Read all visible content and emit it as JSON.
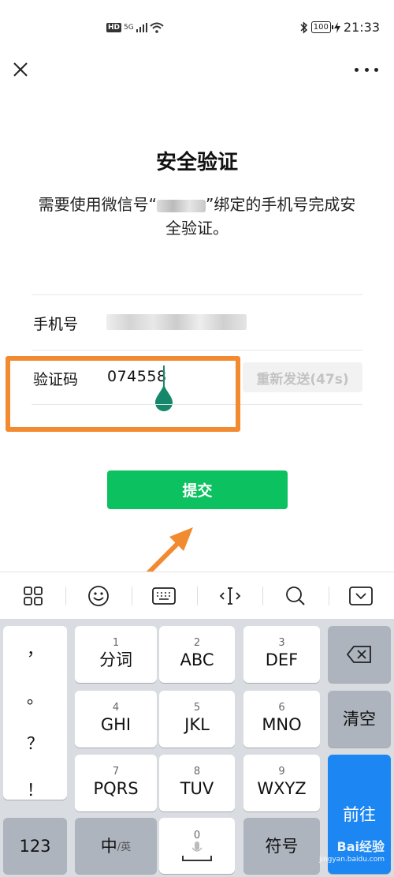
{
  "status_bar": {
    "network": "HD",
    "signal": "5G",
    "battery": "100",
    "time": "21:33"
  },
  "page": {
    "title": "安全验证",
    "desc_prefix": "需要使用微信号“",
    "desc_suffix": "”绑定的手机号完成安全验证。"
  },
  "form": {
    "phone_label": "手机号",
    "code_label": "验证码",
    "code_value": "074558",
    "resend_label": "重新发送(47s)"
  },
  "submit_label": "提交",
  "keyboard": {
    "punctuation": [
      "，",
      "。",
      "？",
      "！"
    ],
    "row1": [
      {
        "num": "1",
        "label": "分词"
      },
      {
        "num": "2",
        "label": "ABC"
      },
      {
        "num": "3",
        "label": "DEF"
      }
    ],
    "row2": [
      {
        "num": "4",
        "label": "GHI"
      },
      {
        "num": "5",
        "label": "JKL"
      },
      {
        "num": "6",
        "label": "MNO"
      }
    ],
    "row3": [
      {
        "num": "7",
        "label": "PQRS"
      },
      {
        "num": "8",
        "label": "TUV"
      },
      {
        "num": "9",
        "label": "WXYZ"
      }
    ],
    "clear_label": "清空",
    "go_label": "前往",
    "num_label": "123",
    "lang_main": "中",
    "lang_sub": "/英",
    "space_num": "0",
    "symbol_label": "符号"
  },
  "watermark": {
    "brand": "Bai经验",
    "url": "jingyan.baidu.com"
  },
  "colors": {
    "accent": "#0cc160",
    "highlight": "#f28a30",
    "key_blue": "#1c86f2"
  }
}
